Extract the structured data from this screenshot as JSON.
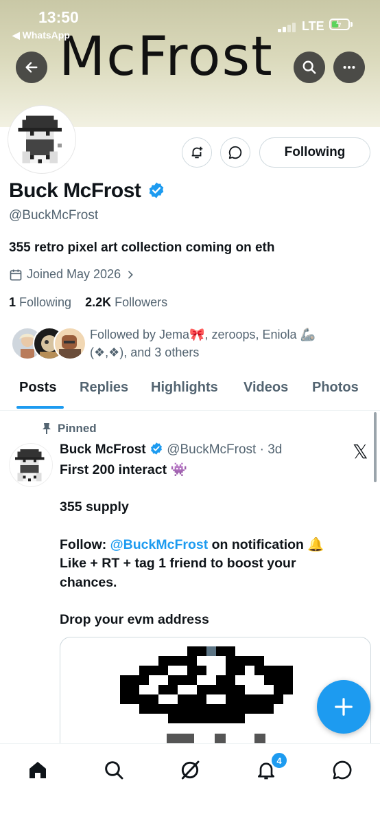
{
  "status_bar": {
    "time": "13:50",
    "back_app": "◀ WhatsApp",
    "carrier": "LTE"
  },
  "banner": {
    "title": "McFrost"
  },
  "profile": {
    "name": "Buck McFrost",
    "handle": "@BuckMcFrost",
    "bio": "355 retro pixel art collection coming on eth",
    "joined": "Joined May 2026",
    "following_count": "1",
    "following_label": "Following",
    "followers_count": "2.2K",
    "followers_label": "Followers",
    "follow_button": "Following",
    "followed_by_line1": "Followed by Jema🎀, zeroops, Eniola 🦾",
    "followed_by_line2": "(❖,❖), and 3 others"
  },
  "tabs": [
    "Posts",
    "Replies",
    "Highlights",
    "Videos",
    "Photos"
  ],
  "post": {
    "pinned_label": "Pinned",
    "author": "Buck McFrost",
    "meta": "@BuckMcFrost · 3d",
    "line1": "First 200 interact 👾",
    "line2": "355 supply",
    "line3_prefix": "Follow: ",
    "line3_mention": "@BuckMcFrost",
    "line3_suffix": " on notification 🔔",
    "line4": "Like + RT + tag 1 friend to boost your",
    "line5": "chances.",
    "line6": "Drop your evm address"
  },
  "bottom_nav": {
    "notifications_badge": "4"
  },
  "colors": {
    "accent": "#1d9bf0",
    "text": "#0f1419",
    "secondary": "#536471"
  }
}
